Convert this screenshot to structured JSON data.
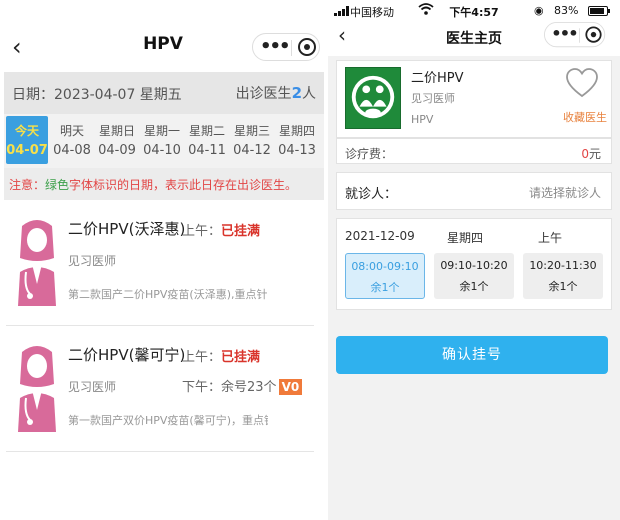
{
  "left": {
    "header": {
      "back": "‹",
      "title": "HPV"
    },
    "date_bar": {
      "label": "日期：2023-04-07 星期五",
      "count_prefix": "出诊医生",
      "count": "2",
      "count_suffix": "人"
    },
    "days": [
      {
        "weekday": "今天",
        "date": "04-07",
        "active": true
      },
      {
        "weekday": "明天",
        "date": "04-08"
      },
      {
        "weekday": "星期日",
        "date": "04-09"
      },
      {
        "weekday": "星期一",
        "date": "04-10"
      },
      {
        "weekday": "星期二",
        "date": "04-11"
      },
      {
        "weekday": "星期三",
        "date": "04-12"
      },
      {
        "weekday": "星期四",
        "date": "04-13"
      }
    ],
    "notice": {
      "prefix": "注意：",
      "green": "绿色",
      "rest": "字体标识的日期，表示此日存在出诊医生。"
    },
    "doctors": [
      {
        "name": "二价HPV(沃泽惠)",
        "title": "见习医师",
        "desc": "第二款国产二价HPV疫苗(沃泽惠),重点针对...",
        "am_label": "上午：",
        "am_status": "已挂满"
      },
      {
        "name": "二价HPV(馨可宁)",
        "title": "见习医师",
        "desc": "第一款国产双价HPV疫苗(馨可宁)，重点针对...",
        "am_label": "上午：",
        "am_status": "已挂满",
        "pm_label": "下午：",
        "pm_remain": "余号23个",
        "pm_badge": "V0"
      }
    ]
  },
  "right": {
    "status_bar": {
      "carrier": "中国移动",
      "time": "下午4:57",
      "battery": "83%"
    },
    "header": {
      "back": "‹",
      "title": "医生主页"
    },
    "profile": {
      "name": "二价HPV",
      "title": "见习医师",
      "category": "HPV",
      "fav_label": "收藏医生"
    },
    "fee": {
      "label": "诊疗费：",
      "value": "0",
      "unit": "元"
    },
    "patient": {
      "label": "就诊人：",
      "placeholder": "请选择就诊人"
    },
    "schedule": {
      "date": "2021-12-09",
      "weekday": "星期四",
      "half": "上午",
      "slots": [
        {
          "time": "08:00-09:10",
          "remain": "余1个",
          "selected": true
        },
        {
          "time": "09:10-10:20",
          "remain": "余1个"
        },
        {
          "time": "10:20-11:30",
          "remain": "余1个"
        }
      ]
    },
    "confirm_label": "确认挂号"
  },
  "colors": {
    "accent_blue": "#3a9fe0",
    "button_blue": "#2fb1ee",
    "status_red": "#d9342b",
    "badge_orange": "#f07a3a",
    "notice_green": "#3ca04a",
    "today_text": "#f7e04a"
  },
  "icons": [
    "back-icon",
    "more-dots-icon",
    "target-icon",
    "doctor-avatar-icon",
    "heart-icon",
    "signal-icon",
    "wifi-icon",
    "battery-icon",
    "hospital-logo"
  ]
}
